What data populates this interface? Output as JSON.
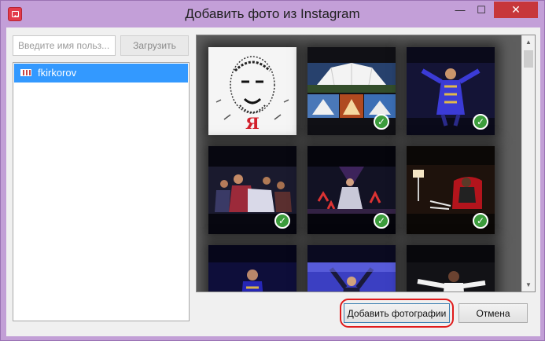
{
  "window": {
    "title": "Добавить фото из Instagram",
    "minimize_label": "—",
    "maximize_label": "☐",
    "close_label": "✕"
  },
  "search": {
    "placeholder": "Введите имя польз...",
    "load_label": "Загрузить"
  },
  "users": [
    {
      "name": "fkirkorov",
      "selected": true
    }
  ],
  "photos": [
    {
      "id": 1,
      "subject": "portrait-sketch",
      "caption": "Я",
      "selected": false
    },
    {
      "id": 2,
      "subject": "tent-building-collage",
      "selected": true
    },
    {
      "id": 3,
      "subject": "stage-performer",
      "selected": true
    },
    {
      "id": 4,
      "subject": "stage-crowd",
      "selected": true
    },
    {
      "id": 5,
      "subject": "stage-show",
      "selected": true
    },
    {
      "id": 6,
      "subject": "red-chair-stage",
      "selected": true
    },
    {
      "id": 7,
      "subject": "blue-stage-performer",
      "selected": false
    },
    {
      "id": 8,
      "subject": "blue-stage-arms-up",
      "selected": false
    },
    {
      "id": 9,
      "subject": "white-suit-performer",
      "selected": false
    }
  ],
  "check_glyph": "✓",
  "scroll": {
    "up": "▲",
    "down": "▼"
  },
  "footer": {
    "add_label": "Добавить фотографии",
    "cancel_label": "Отмена"
  },
  "colors": {
    "titlebar": "#c39fd8",
    "close": "#c7373b",
    "selection": "#3399ff",
    "highlight_ring": "#e01b1b",
    "check": "#3c9c3c"
  }
}
